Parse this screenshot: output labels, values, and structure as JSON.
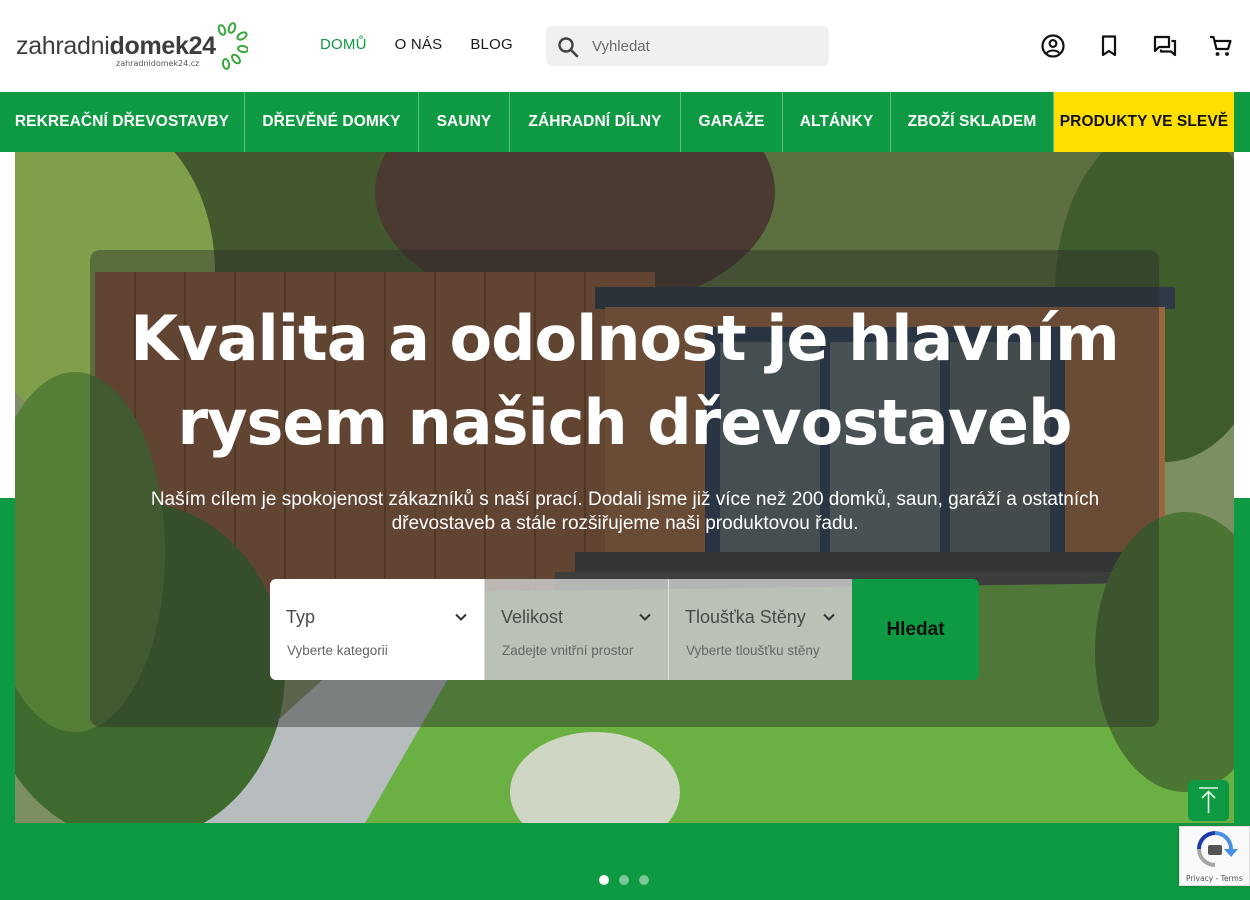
{
  "header": {
    "logo": {
      "text_plain": "zahradni",
      "text_bold": "domek24",
      "domain": "zahradnidomek24.cz"
    },
    "nav": [
      {
        "label": "DOMŮ",
        "active": true
      },
      {
        "label": "O NÁS",
        "active": false
      },
      {
        "label": "BLOG",
        "active": false
      }
    ],
    "search": {
      "placeholder": "Vyhledat"
    },
    "icons": [
      "account-icon",
      "bookmark-icon",
      "chat-icon",
      "cart-icon"
    ]
  },
  "categories": [
    {
      "label": "REKREAČNÍ DŘEVOSTAVBY"
    },
    {
      "label": "DŘEVĚNÉ DOMKY"
    },
    {
      "label": "SAUNY"
    },
    {
      "label": "ZÁHRADNÍ DÍLNY"
    },
    {
      "label": "GARÁŽE"
    },
    {
      "label": "ALTÁNKY"
    },
    {
      "label": "ZBOŽÍ SKLADEM"
    },
    {
      "label": "PRODUKTY VE SLEVĚ",
      "highlight": true
    }
  ],
  "hero": {
    "title_line1": "Kvalita a odolnost je hlavním",
    "title_line2": "rysem našich dřevostaveb",
    "subtitle_line1": "Naším cílem je spokojenost zákazníků s naší prací. Dodali jsme již více než 200 domků, saun, garáží a ostatních",
    "subtitle_line2": "dřevostaveb a stále rozšiřujeme naši produktovou řadu.",
    "filters": [
      {
        "title": "Typ",
        "hint": "Vyberte kategorii"
      },
      {
        "title": "Velikost",
        "hint": "Zadejte vnitřní prostor"
      },
      {
        "title": "Tloušťka Stěny",
        "hint": "Vyberte tloušťku stěny"
      }
    ],
    "search_button": "Hledat",
    "carousel_pages": 3,
    "carousel_active": 1
  },
  "recaptcha": {
    "privacy": "Privacy",
    "separator": " - ",
    "terms": "Terms"
  },
  "colors": {
    "brand_green": "#0d9a43",
    "sale_yellow": "#ffdf00"
  }
}
